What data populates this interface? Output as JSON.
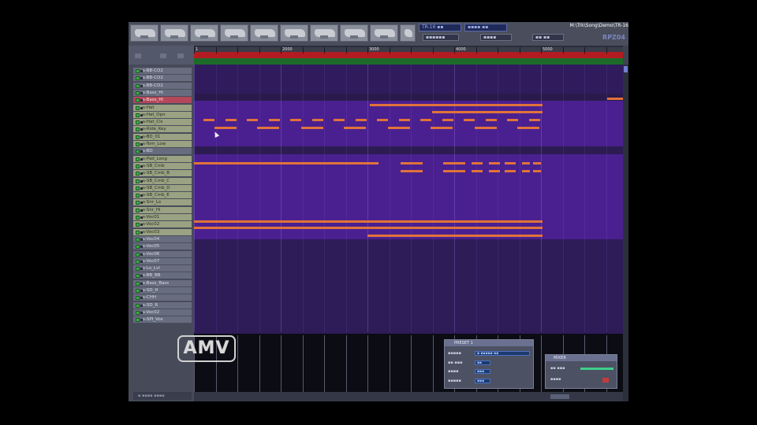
{
  "window": {
    "title": "M:\\Trk\\Song\\Demo\\TR-16",
    "brand": "RPZ04"
  },
  "header": {
    "control_a": "TR-16 ▪▪",
    "control_b": "▪▪▪▪ ▪▪",
    "control_c": "▪▪▪▪▪▪",
    "control_d": "▪▪▪▪",
    "control_e": "▪▪ ▪▪"
  },
  "timeline": {
    "bars": [
      "1",
      "2000",
      "3000",
      "4000",
      "5000"
    ]
  },
  "tracks": [
    {
      "name": "s-BB-CO2",
      "state": "normal"
    },
    {
      "name": "s-BB-CO2",
      "state": "normal"
    },
    {
      "name": "s-BB-CO2",
      "state": "normal"
    },
    {
      "name": "s-Bass_Hi",
      "state": "normal"
    },
    {
      "name": "s-Bass_Hl",
      "state": "red"
    },
    {
      "name": "s-Hat",
      "state": "sel"
    },
    {
      "name": "s-Hat_Opn",
      "state": "sel"
    },
    {
      "name": "s-Hat_Cls",
      "state": "sel"
    },
    {
      "name": "s-Ride_Key",
      "state": "sel"
    },
    {
      "name": "s-BD_01",
      "state": "sel"
    },
    {
      "name": "s-Tom_Low",
      "state": "sel"
    },
    {
      "name": "s-BD",
      "state": "normal"
    },
    {
      "name": "s-Pad_Long",
      "state": "sel"
    },
    {
      "name": "s-SB_Cmb",
      "state": "sel"
    },
    {
      "name": "s-SB_Cmb_B",
      "state": "sel"
    },
    {
      "name": "s-SB_Cmb_C",
      "state": "sel"
    },
    {
      "name": "s-SB_Cmb_D",
      "state": "sel"
    },
    {
      "name": "s-SB_Cmb_E",
      "state": "sel"
    },
    {
      "name": "s-Snr_Lo",
      "state": "sel"
    },
    {
      "name": "s-Snr_Hi",
      "state": "sel"
    },
    {
      "name": "s-Voc01",
      "state": "sel"
    },
    {
      "name": "s-Voc02",
      "state": "sel"
    },
    {
      "name": "s-Voc03",
      "state": "sel"
    },
    {
      "name": "s-Voc04",
      "state": "normal"
    },
    {
      "name": "s-Voc05",
      "state": "normal"
    },
    {
      "name": "s-Voc06",
      "state": "normal"
    },
    {
      "name": "s-Voc07",
      "state": "normal"
    },
    {
      "name": "s-Lo_Lvl",
      "state": "normal"
    },
    {
      "name": "s-BB_BB",
      "state": "normal"
    },
    {
      "name": "s-Bass_Bass",
      "state": "normal"
    },
    {
      "name": "s-SD_H",
      "state": "normal"
    },
    {
      "name": "s-CHH",
      "state": "normal"
    },
    {
      "name": "s-SD_R",
      "state": "normal"
    },
    {
      "name": "s-Voc02",
      "state": "normal"
    },
    {
      "name": "s-SPI_Vox",
      "state": "normal"
    }
  ],
  "track_footer": "▪ ▪▪▪▪ ▪▪▪▪",
  "panel_pattern": {
    "title": "PRESET 1",
    "rows": [
      {
        "label": "▪▪▪▪▪",
        "value": "▪ ▪▪▪▪▪ ▪▪"
      },
      {
        "label": "▪▪ ▪▪▪",
        "value": "▪▪"
      },
      {
        "label": "▪▪▪▪",
        "value": "▪▪▪"
      },
      {
        "label": "▪▪▪▪▪",
        "value": "▪▪▪"
      }
    ]
  },
  "panel_mixer": {
    "title": "MIXER",
    "rows": [
      {
        "label": "▪▪ ▪▪▪"
      },
      {
        "label": "▪▪▪▪"
      }
    ]
  },
  "logo": {
    "text": "AMV"
  },
  "colors": {
    "note": "#e0733a",
    "roll_bg": "#2a1f48",
    "roll_lane_active": "#4a2090",
    "ruler_red": "#b21b22",
    "ruler_green": "#1e6a2a",
    "selected_track": "#9aa283"
  },
  "icons": {
    "track_led": "led-green-square",
    "scroll_thumb": "scroll-thumb"
  }
}
